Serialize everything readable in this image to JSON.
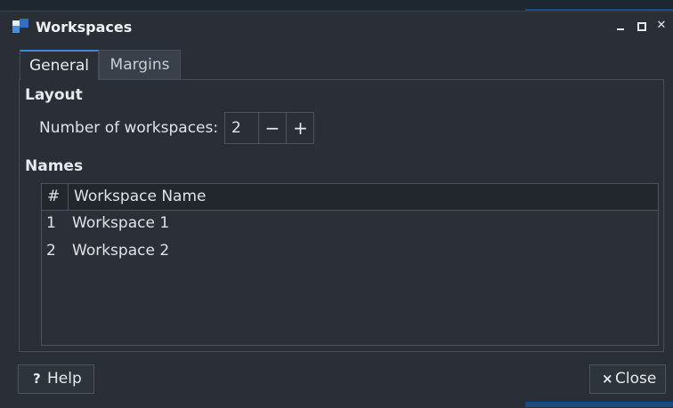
{
  "window": {
    "title": "Workspaces"
  },
  "tabs": [
    {
      "label": "General",
      "active": true
    },
    {
      "label": "Margins",
      "active": false
    }
  ],
  "layout": {
    "heading": "Layout",
    "num_label": "Number of workspaces:",
    "num_value": "2",
    "minus_symbol": "−",
    "plus_symbol": "+"
  },
  "names": {
    "heading": "Names",
    "columns": [
      "#",
      "Workspace Name"
    ],
    "rows": [
      {
        "num": "1",
        "name": "Workspace 1"
      },
      {
        "num": "2",
        "name": "Workspace 2"
      }
    ]
  },
  "buttons": {
    "help_icon": "?",
    "help_label": "Help",
    "close_icon": "×",
    "close_label": "Close"
  },
  "colors": {
    "accent": "#3c8ae0",
    "background": "#2a2f37"
  },
  "icons": {
    "app": "workspaces-icon",
    "minimize": "minimize-icon",
    "maximize": "maximize-icon",
    "close": "close-icon"
  }
}
